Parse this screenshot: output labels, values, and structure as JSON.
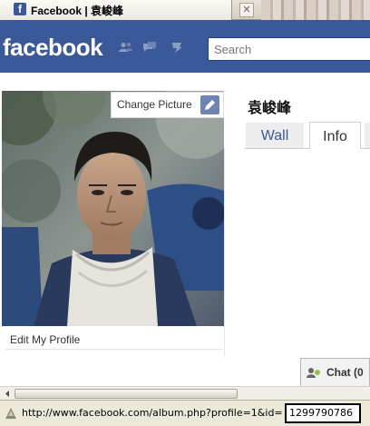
{
  "browser": {
    "tab_title": "Facebook | 袁峻峰",
    "tab_favicon": "f",
    "close_icon": "close-icon"
  },
  "header": {
    "logo": "facebook",
    "search_placeholder": "Search",
    "jewels": [
      "friend-requests-icon",
      "messages-icon",
      "notifications-icon"
    ],
    "brand_color": "#3b5998"
  },
  "profile": {
    "change_picture": "Change Picture",
    "name": "袁峻峰",
    "tabs": [
      "Wall",
      "Info"
    ],
    "active_tab": "Info",
    "edit_profile": "Edit My Profile"
  },
  "chat": {
    "label": "Chat (0"
  },
  "status": {
    "url": "http://www.facebook.com/album.php?profile=1&id=",
    "id": "1299790786"
  }
}
